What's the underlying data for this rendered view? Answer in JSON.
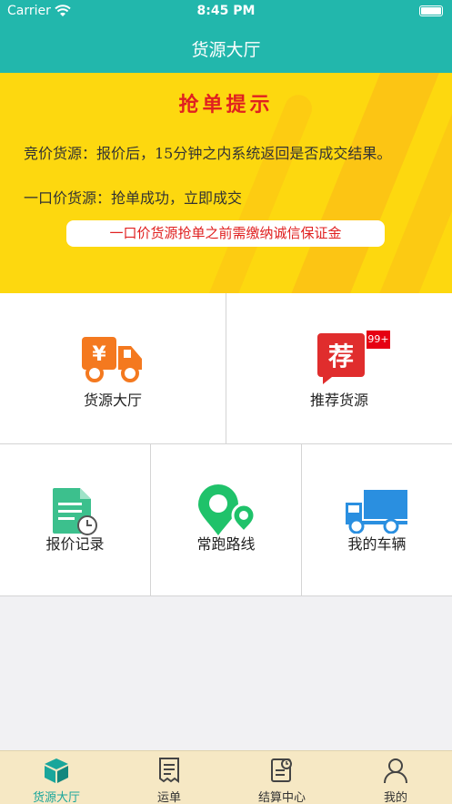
{
  "status_bar": {
    "carrier": "Carrier",
    "time": "8:45 PM"
  },
  "header": {
    "title": "货源大厅"
  },
  "banner": {
    "title": "抢单提示",
    "line1": "竞价货源：报价后，15分钟之内系统返回是否成交结果。",
    "line2": "一口价货源：抢单成功，立即成交",
    "notice": "一口价货源抢单之前需缴纳诚信保证金",
    "colors": {
      "background": "#fdd80f",
      "title": "#e02020"
    }
  },
  "grid": {
    "items": [
      {
        "label": "货源大厅",
        "icon": "truck-yen-icon"
      },
      {
        "label": "推荐货源",
        "icon": "recommend-icon",
        "badge": "99+",
        "icon_text": "荐"
      },
      {
        "label": "报价记录",
        "icon": "quote-record-icon"
      },
      {
        "label": "常跑路线",
        "icon": "route-pin-icon"
      },
      {
        "label": "我的车辆",
        "icon": "blue-truck-icon"
      }
    ]
  },
  "tabbar": {
    "items": [
      {
        "label": "货源大厅",
        "icon": "cargo-box-icon",
        "active": true
      },
      {
        "label": "运单",
        "icon": "waybill-icon",
        "active": false
      },
      {
        "label": "结算中心",
        "icon": "settlement-icon",
        "active": false
      },
      {
        "label": "我的",
        "icon": "profile-icon",
        "active": false
      }
    ],
    "colors": {
      "active": "#1aa69b",
      "background": "#f6e8c4"
    }
  },
  "colors": {
    "primary": "#22b7ac"
  }
}
